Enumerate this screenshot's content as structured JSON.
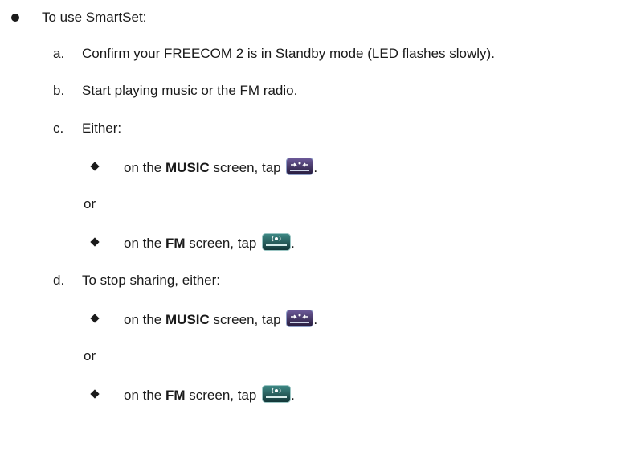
{
  "intro": {
    "bullet": "To use SmartSet:"
  },
  "steps": [
    {
      "marker": "a.",
      "text": "Confirm your FREECOM 2 is in Standby mode (LED flashes slowly)."
    },
    {
      "marker": "b.",
      "text": "Start playing music or the FM radio."
    },
    {
      "marker": "c.",
      "text": "Either:"
    },
    {
      "marker": "d.",
      "text": "To stop sharing, either:"
    }
  ],
  "sub_c": {
    "music": {
      "pre": "on the ",
      "bold": "MUSIC",
      "post": " screen, tap ",
      "end": "."
    },
    "or": "or",
    "fm": {
      "pre": "on the ",
      "bold": "FM",
      "post": " screen, tap ",
      "end": "."
    }
  },
  "sub_d": {
    "music": {
      "pre": "on the ",
      "bold": "MUSIC",
      "post": " screen, tap ",
      "end": "."
    },
    "or": "or",
    "fm": {
      "pre": "on the ",
      "bold": "FM",
      "post": " screen, tap ",
      "end": "."
    }
  },
  "icons": {
    "music_sharing": {
      "name": "music-sharing-icon",
      "label": "MUSIC SHARING",
      "color": "#3b2d5c"
    },
    "auto_tuning": {
      "name": "auto-tuning-icon",
      "label": "AUTO TUNING",
      "color": "#1f5a5a"
    }
  }
}
